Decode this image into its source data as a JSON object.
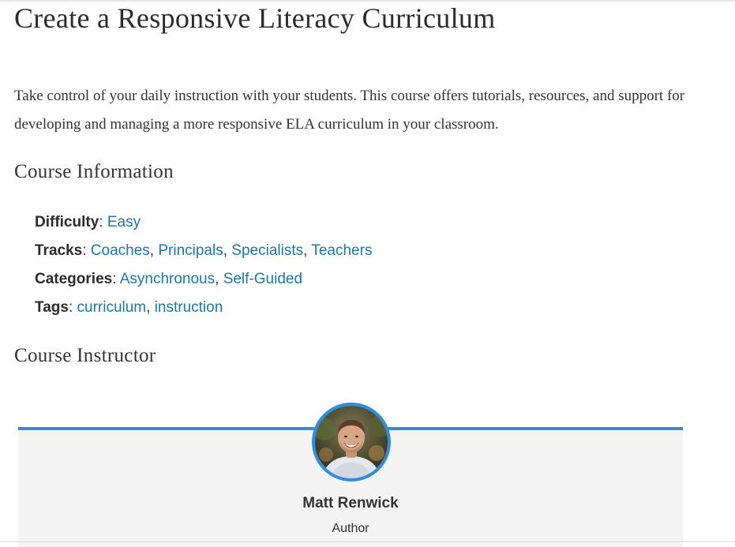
{
  "course": {
    "title": "Create a Responsive Literacy Curriculum",
    "description": "Take control of your daily instruction with your students. This course offers tutorials, resources, and support for developing and managing a more responsive ELA curriculum in your classroom."
  },
  "course_information": {
    "heading": "Course Information",
    "difficulty": {
      "label": "Difficulty",
      "values": [
        "Easy"
      ]
    },
    "tracks": {
      "label": "Tracks",
      "values": [
        "Coaches",
        "Principals",
        "Specialists",
        "Teachers"
      ]
    },
    "categories": {
      "label": "Categories",
      "values": [
        "Asynchronous",
        "Self-Guided"
      ]
    },
    "tags": {
      "label": "Tags",
      "values": [
        "curriculum",
        "instruction"
      ]
    }
  },
  "course_instructor": {
    "heading": "Course Instructor",
    "name": "Matt Renwick",
    "role": "Author",
    "avatar_icon": "instructor-photo"
  },
  "colors": {
    "link": "#1f74a8",
    "accent": "#2f8ce0",
    "card_background": "#f4f4f4",
    "text": "#333333"
  }
}
